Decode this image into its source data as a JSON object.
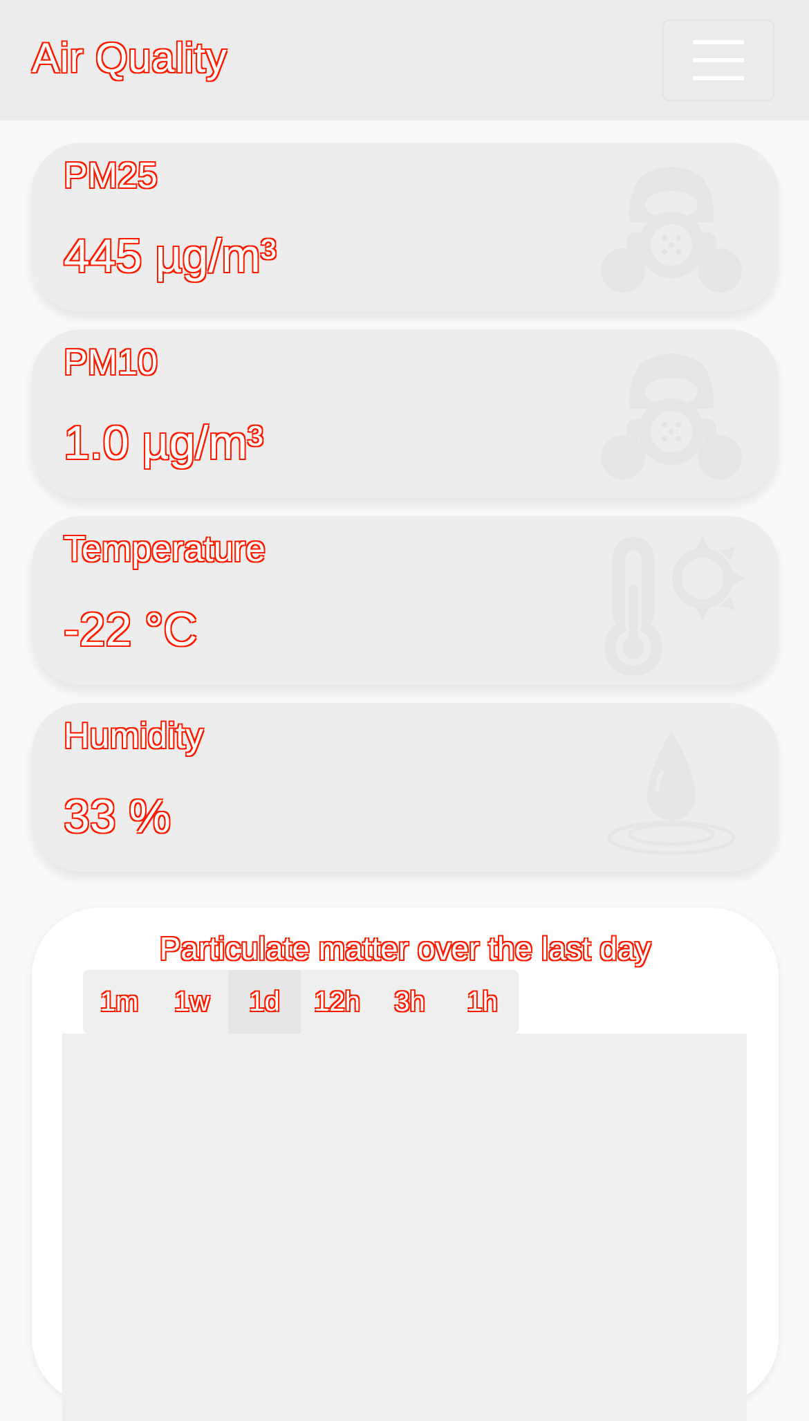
{
  "navbar": {
    "brand": "Air Quality"
  },
  "cards": [
    {
      "label": "PM25",
      "value": "445 µg/m³",
      "icon": "gas-mask-icon"
    },
    {
      "label": "PM10",
      "value": "1.0 µg/m³",
      "icon": "gas-mask-icon"
    },
    {
      "label": "Temperature",
      "value": "-22 °C",
      "icon": "thermometer-sun-icon"
    },
    {
      "label": "Humidity",
      "value": "33 %",
      "icon": "water-drop-icon"
    }
  ],
  "chart": {
    "title": "Particulate matter over the last day",
    "ranges": [
      "1m",
      "1w",
      "1d",
      "12h",
      "3h",
      "1h"
    ],
    "selected_range": "1d"
  },
  "colors": {
    "text_outline": "#ff1a00",
    "text_glow": "#ffd400",
    "card_bg": "#ededed",
    "navbar_bg": "#ececec"
  }
}
